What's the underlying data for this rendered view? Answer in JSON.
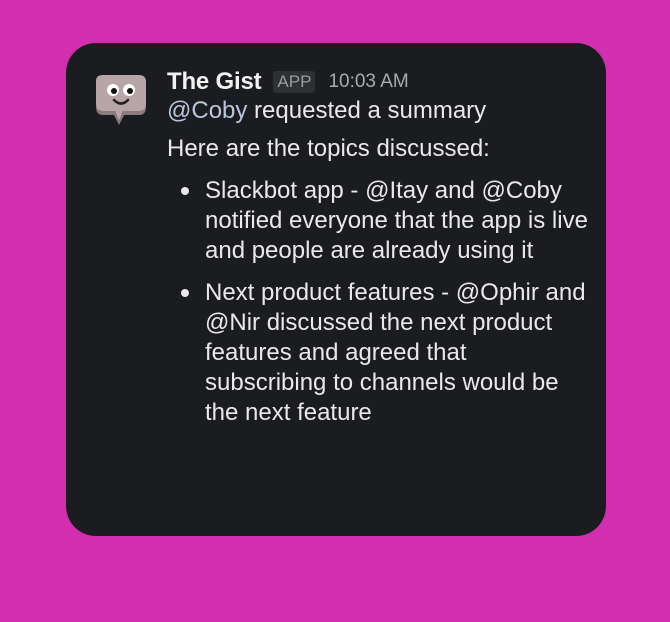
{
  "message": {
    "bot_name": "The Gist",
    "badge": "APP",
    "timestamp": "10:03 AM",
    "request": {
      "mention": "@Coby",
      "text": " requested a summary"
    },
    "intro": "Here are the topics discussed:",
    "topics": [
      "Slackbot app - @Itay and @Coby notified everyone that the app is live and people are already using it",
      "Next product features - @Ophir and @Nir discussed the next product features and agreed that subscribing to channels would be the next feature"
    ]
  },
  "colors": {
    "background": "#d22fb0",
    "card": "#1b1c1f",
    "mention": "#b9c4dd"
  },
  "icons": {
    "avatar": "speech-bubble-mascot-icon"
  }
}
